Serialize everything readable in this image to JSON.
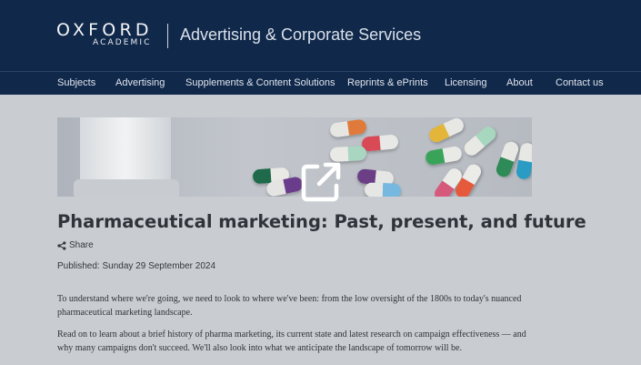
{
  "brand": {
    "logo_main": "OXFORD",
    "logo_sub": "ACADEMIC",
    "site_title": "Advertising & Corporate Services"
  },
  "nav": [
    {
      "label": "Subjects"
    },
    {
      "label": "Advertising"
    },
    {
      "label": "Supplements & Content Solutions"
    },
    {
      "label": "Reprints & ePrints"
    },
    {
      "label": "Licensing"
    },
    {
      "label": "About"
    },
    {
      "label": "Contact us"
    }
  ],
  "article": {
    "title": "Pharmaceutical marketing: Past, present, and future",
    "share_label": "Share",
    "published": "Published: Sunday 29 September 2024",
    "paragraphs": [
      "To understand where we're going, we need to look to where we've been: from the low oversight of the 1800s to today's nuanced pharmaceutical marketing landscape.",
      "Read on to learn about a brief history of pharma marketing, its current state and latest research on campaign effectiveness — and why many campaigns don't succeed. We'll also look into what we anticipate the landscape of tomorrow will be."
    ]
  },
  "icons": {
    "hero_overlay": "external-link-icon",
    "share": "share-icon"
  },
  "colors": {
    "header_bg": "#10284a",
    "page_bg": "#c9cdd2",
    "text": "#30343a"
  }
}
